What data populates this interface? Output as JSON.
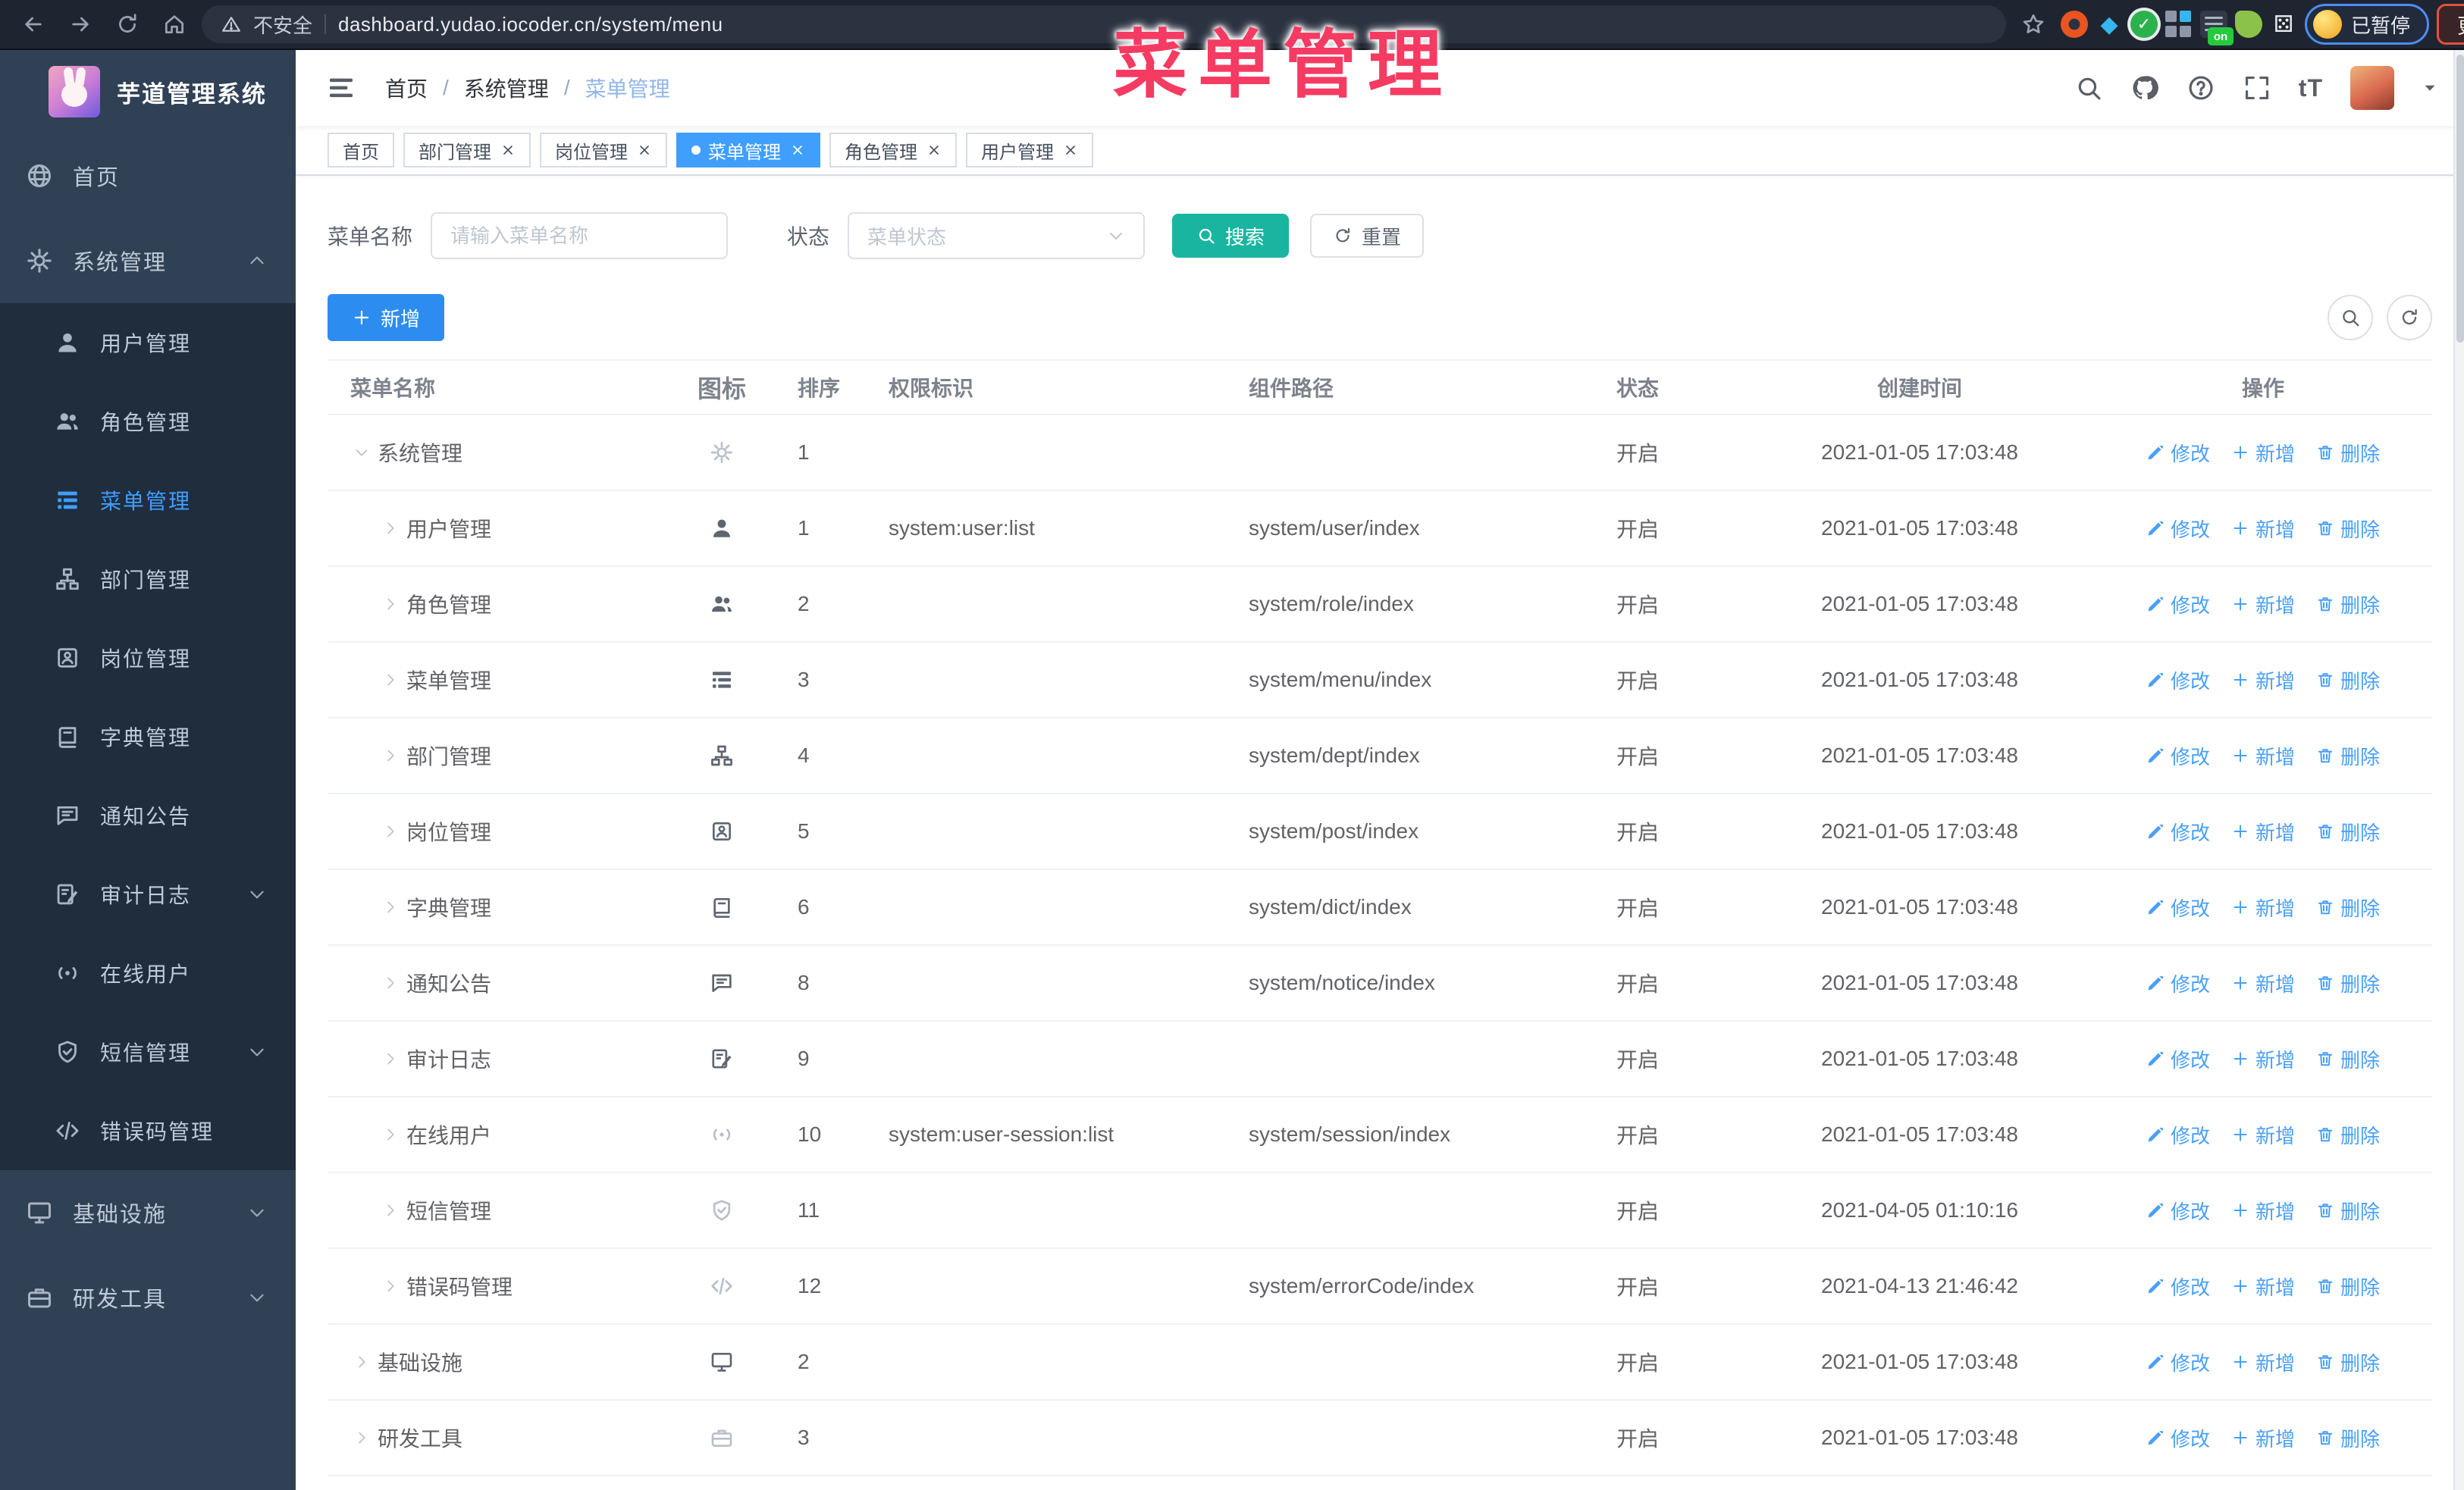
{
  "browser": {
    "security_label": "不安全",
    "url": "dashboard.yudao.iocoder.cn/system/menu",
    "paused_badge": "已暂停",
    "update_label": "更新"
  },
  "overlay_title": "菜单管理",
  "colors": {
    "accent": "#409eff",
    "search_button": "#1ab5a0",
    "add_button": "#2d8cf0",
    "overlay": "#f53b62"
  },
  "sidebar": {
    "logo_title": "芋道管理系统",
    "items": [
      {
        "label": "首页",
        "icon": "home",
        "level": 0
      },
      {
        "label": "系统管理",
        "icon": "gear",
        "level": 0,
        "arrow": "up"
      },
      {
        "label": "用户管理",
        "icon": "user",
        "level": 1
      },
      {
        "label": "角色管理",
        "icon": "peoples",
        "level": 1
      },
      {
        "label": "菜单管理",
        "icon": "tree-table",
        "level": 1,
        "active": true
      },
      {
        "label": "部门管理",
        "icon": "tree",
        "level": 1
      },
      {
        "label": "岗位管理",
        "icon": "post",
        "level": 1
      },
      {
        "label": "字典管理",
        "icon": "dict",
        "level": 1
      },
      {
        "label": "通知公告",
        "icon": "message",
        "level": 1
      },
      {
        "label": "审计日志",
        "icon": "log",
        "level": 1,
        "arrow": "down"
      },
      {
        "label": "在线用户",
        "icon": "online",
        "level": 1
      },
      {
        "label": "短信管理",
        "icon": "sms",
        "level": 1,
        "arrow": "down"
      },
      {
        "label": "错误码管理",
        "icon": "code",
        "level": 1
      },
      {
        "label": "基础设施",
        "icon": "monitor",
        "level": 0,
        "arrow": "down"
      },
      {
        "label": "研发工具",
        "icon": "tool",
        "level": 0,
        "arrow": "down"
      }
    ]
  },
  "breadcrumb": [
    "首页",
    "系统管理",
    "菜单管理"
  ],
  "tabs": [
    {
      "label": "首页",
      "closable": false,
      "active": false
    },
    {
      "label": "部门管理",
      "closable": true,
      "active": false
    },
    {
      "label": "岗位管理",
      "closable": true,
      "active": false
    },
    {
      "label": "菜单管理",
      "closable": true,
      "active": true
    },
    {
      "label": "角色管理",
      "closable": true,
      "active": false
    },
    {
      "label": "用户管理",
      "closable": true,
      "active": false
    }
  ],
  "filter": {
    "name_label": "菜单名称",
    "name_placeholder": "请输入菜单名称",
    "status_label": "状态",
    "status_placeholder": "菜单状态",
    "search_label": "搜索",
    "reset_label": "重置"
  },
  "toolbar": {
    "add_label": "新增"
  },
  "table": {
    "headers": [
      "菜单名称",
      "图标",
      "排序",
      "权限标识",
      "组件路径",
      "状态",
      "创建时间",
      "操作"
    ],
    "action_labels": {
      "edit": "修改",
      "add": "新增",
      "delete": "删除"
    },
    "rows": [
      {
        "name": "系统管理",
        "icon": "gear",
        "icon_light": true,
        "sort": "1",
        "perm": "",
        "path": "",
        "status": "开启",
        "time": "2021-01-05 17:03:48",
        "level": 0,
        "expanded": true
      },
      {
        "name": "用户管理",
        "icon": "user",
        "icon_light": false,
        "sort": "1",
        "perm": "system:user:list",
        "path": "system/user/index",
        "status": "开启",
        "time": "2021-01-05 17:03:48",
        "level": 1,
        "expanded": false
      },
      {
        "name": "角色管理",
        "icon": "peoples",
        "icon_light": false,
        "sort": "2",
        "perm": "",
        "path": "system/role/index",
        "status": "开启",
        "time": "2021-01-05 17:03:48",
        "level": 1,
        "expanded": false
      },
      {
        "name": "菜单管理",
        "icon": "tree-table",
        "icon_light": false,
        "sort": "3",
        "perm": "",
        "path": "system/menu/index",
        "status": "开启",
        "time": "2021-01-05 17:03:48",
        "level": 1,
        "expanded": false
      },
      {
        "name": "部门管理",
        "icon": "tree",
        "icon_light": false,
        "sort": "4",
        "perm": "",
        "path": "system/dept/index",
        "status": "开启",
        "time": "2021-01-05 17:03:48",
        "level": 1,
        "expanded": false
      },
      {
        "name": "岗位管理",
        "icon": "post",
        "icon_light": false,
        "sort": "5",
        "perm": "",
        "path": "system/post/index",
        "status": "开启",
        "time": "2021-01-05 17:03:48",
        "level": 1,
        "expanded": false
      },
      {
        "name": "字典管理",
        "icon": "dict",
        "icon_light": false,
        "sort": "6",
        "perm": "",
        "path": "system/dict/index",
        "status": "开启",
        "time": "2021-01-05 17:03:48",
        "level": 1,
        "expanded": false
      },
      {
        "name": "通知公告",
        "icon": "message",
        "icon_light": false,
        "sort": "8",
        "perm": "",
        "path": "system/notice/index",
        "status": "开启",
        "time": "2021-01-05 17:03:48",
        "level": 1,
        "expanded": false
      },
      {
        "name": "审计日志",
        "icon": "log",
        "icon_light": false,
        "sort": "9",
        "perm": "",
        "path": "",
        "status": "开启",
        "time": "2021-01-05 17:03:48",
        "level": 1,
        "expanded": false
      },
      {
        "name": "在线用户",
        "icon": "online",
        "icon_light": true,
        "sort": "10",
        "perm": "system:user-session:list",
        "path": "system/session/index",
        "status": "开启",
        "time": "2021-01-05 17:03:48",
        "level": 1,
        "expanded": false
      },
      {
        "name": "短信管理",
        "icon": "sms",
        "icon_light": true,
        "sort": "11",
        "perm": "",
        "path": "",
        "status": "开启",
        "time": "2021-04-05 01:10:16",
        "level": 1,
        "expanded": false
      },
      {
        "name": "错误码管理",
        "icon": "code",
        "icon_light": true,
        "sort": "12",
        "perm": "",
        "path": "system/errorCode/index",
        "status": "开启",
        "time": "2021-04-13 21:46:42",
        "level": 1,
        "expanded": false
      },
      {
        "name": "基础设施",
        "icon": "monitor",
        "icon_light": false,
        "sort": "2",
        "perm": "",
        "path": "",
        "status": "开启",
        "time": "2021-01-05 17:03:48",
        "level": 0,
        "expanded": false
      },
      {
        "name": "研发工具",
        "icon": "tool",
        "icon_light": true,
        "sort": "3",
        "perm": "",
        "path": "",
        "status": "开启",
        "time": "2021-01-05 17:03:48",
        "level": 0,
        "expanded": false
      }
    ]
  }
}
